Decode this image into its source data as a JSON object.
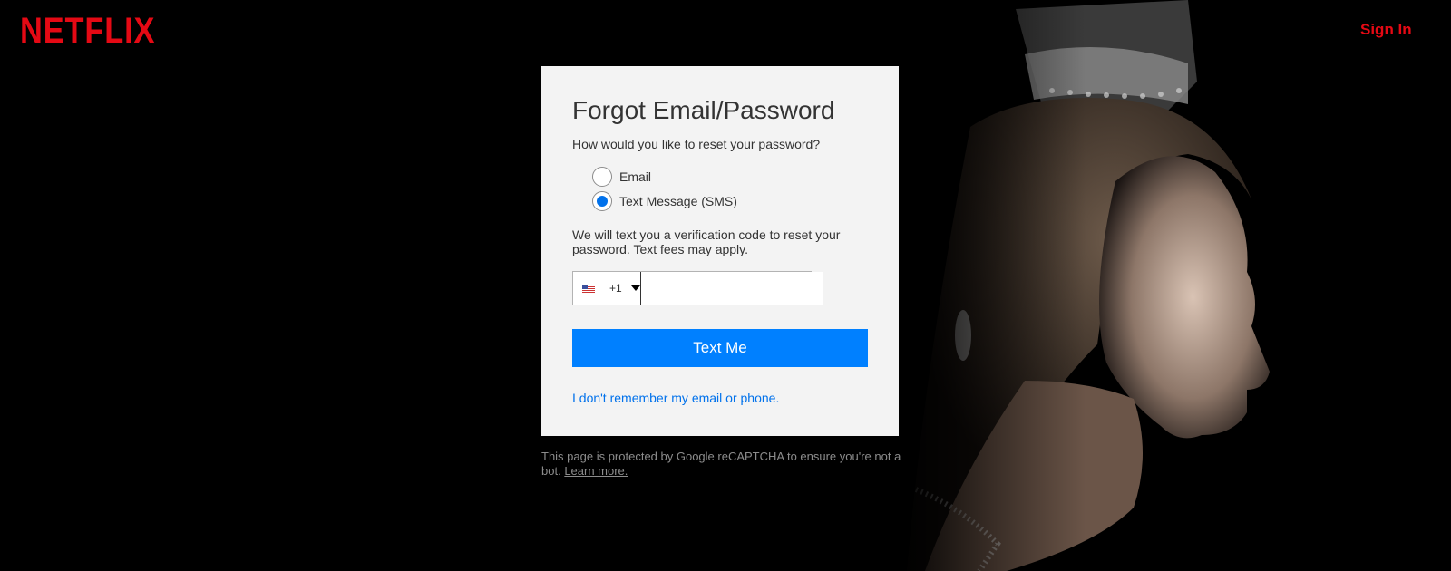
{
  "header": {
    "logo_text": "NETFLIX",
    "sign_in_label": "Sign In"
  },
  "form": {
    "title": "Forgot Email/Password",
    "prompt": "How would you like to reset your password?",
    "options": [
      {
        "label": "Email",
        "selected": false
      },
      {
        "label": "Text Message (SMS)",
        "selected": true
      }
    ],
    "info": "We will text you a verification code to reset your password. Text fees may apply.",
    "phone": {
      "country_code": "+1",
      "flag_icon": "us-flag-icon",
      "value": "",
      "placeholder": ""
    },
    "submit_label": "Text Me",
    "help_link": "I don't remember my email or phone."
  },
  "footer": {
    "recaptcha_text": "This page is protected by Google reCAPTCHA to ensure you're not a bot.",
    "learn_more": "Learn more."
  },
  "colors": {
    "brand_red": "#e50914",
    "button_blue": "#0080ff",
    "link_blue": "#0071eb",
    "card_bg": "#f3f3f3"
  }
}
